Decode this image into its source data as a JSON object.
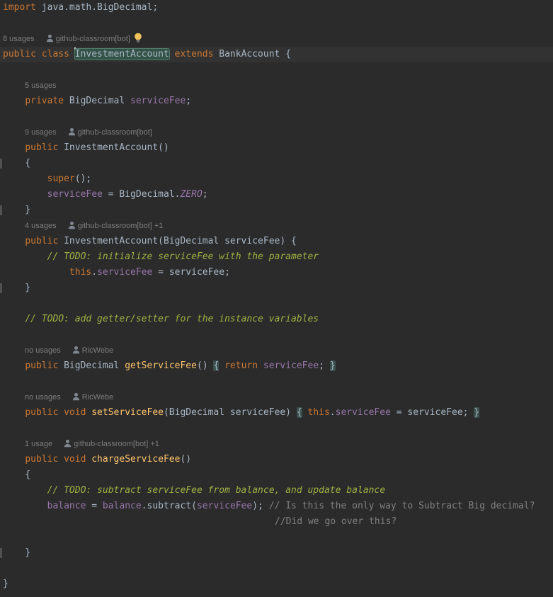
{
  "colors": {
    "background": "#2b2b2b",
    "keyword": "#cc7832",
    "plain": "#a9b7c6",
    "method_name": "#ffc66d",
    "field": "#9876aa",
    "constant": "#9876aa",
    "todo_comment": "#9fb342",
    "comment": "#808080",
    "inlay_hint": "#7d7d7d",
    "identifier_highlight_bg": "#355247",
    "identifier_highlight_border": "#4e7a68",
    "matched_brace_bg": "#3b514d",
    "current_line_bg": "#323232",
    "caret": "#dddddd",
    "fold_marker": "#515151",
    "user_icon": "#808790",
    "bulb_icon": "#f2c55c",
    "bulb_base": "#9aa0a6"
  },
  "editor": {
    "language": "Java",
    "lines": [
      {
        "kind": "code",
        "tokens": [
          {
            "t": "import",
            "c": "kw"
          },
          {
            "t": " java.math.BigDecimal;",
            "c": "pl"
          }
        ]
      },
      {
        "kind": "code",
        "tokens": []
      },
      {
        "kind": "inlay",
        "tokens": [
          {
            "t": "8 usages",
            "c": "inlay"
          },
          {
            "sp": 16
          },
          {
            "icon": "user"
          },
          {
            "sp": 3
          },
          {
            "t": "github-classroom[bot]",
            "c": "inlay"
          },
          {
            "sp": 5
          },
          {
            "icon": "bulb"
          }
        ]
      },
      {
        "kind": "code",
        "current": true,
        "tokens": [
          {
            "t": "public class ",
            "c": "kw"
          },
          {
            "caret": true
          },
          {
            "t": "InvestmentAccount",
            "c": "pl",
            "hl": "ident"
          },
          {
            "t": " ",
            "c": "pl"
          },
          {
            "t": "extends",
            "c": "kw"
          },
          {
            "t": " BankAccount {",
            "c": "pl"
          }
        ]
      },
      {
        "kind": "code",
        "tokens": []
      },
      {
        "kind": "inlay",
        "tokens": [
          {
            "sp": 31
          },
          {
            "t": "5 usages",
            "c": "inlay"
          }
        ]
      },
      {
        "kind": "code",
        "tokens": [
          {
            "t": "    ",
            "c": "pl"
          },
          {
            "t": "private",
            "c": "kw"
          },
          {
            "t": " BigDecimal ",
            "c": "pl"
          },
          {
            "t": "serviceFee",
            "c": "fld"
          },
          {
            "t": ";",
            "c": "pl"
          }
        ]
      },
      {
        "kind": "code",
        "tokens": []
      },
      {
        "kind": "inlay",
        "tokens": [
          {
            "sp": 31
          },
          {
            "t": "9 usages",
            "c": "inlay"
          },
          {
            "sp": 16
          },
          {
            "icon": "user"
          },
          {
            "sp": 3
          },
          {
            "t": "github-classroom[bot]",
            "c": "inlay"
          }
        ]
      },
      {
        "kind": "code",
        "tokens": [
          {
            "t": "    ",
            "c": "pl"
          },
          {
            "t": "public",
            "c": "kw"
          },
          {
            "t": " InvestmentAccount()",
            "c": "pl"
          }
        ]
      },
      {
        "kind": "code",
        "gutterMark": true,
        "tokens": [
          {
            "t": "    {",
            "c": "pl"
          }
        ]
      },
      {
        "kind": "code",
        "tokens": [
          {
            "t": "        ",
            "c": "pl"
          },
          {
            "t": "super",
            "c": "kw"
          },
          {
            "t": "();",
            "c": "pl"
          }
        ]
      },
      {
        "kind": "code",
        "tokens": [
          {
            "t": "        ",
            "c": "pl"
          },
          {
            "t": "serviceFee",
            "c": "fld"
          },
          {
            "t": " = BigDecimal.",
            "c": "pl"
          },
          {
            "t": "ZERO",
            "c": "cst"
          },
          {
            "t": ";",
            "c": "pl"
          }
        ]
      },
      {
        "kind": "code",
        "gutterMark": true,
        "tokens": [
          {
            "t": "    }",
            "c": "pl"
          }
        ]
      },
      {
        "kind": "inlay",
        "tokens": [
          {
            "sp": 31
          },
          {
            "t": "4 usages",
            "c": "inlay"
          },
          {
            "sp": 16
          },
          {
            "icon": "user"
          },
          {
            "sp": 3
          },
          {
            "t": "github-classroom[bot] +1",
            "c": "inlay"
          }
        ]
      },
      {
        "kind": "code",
        "tokens": [
          {
            "t": "    ",
            "c": "pl"
          },
          {
            "t": "public",
            "c": "kw"
          },
          {
            "t": " InvestmentAccount(BigDecimal serviceFee) {",
            "c": "pl"
          }
        ]
      },
      {
        "kind": "code",
        "tokens": [
          {
            "t": "        ",
            "c": "pl"
          },
          {
            "t": "// TODO: initialize serviceFee with the parameter",
            "c": "todo"
          }
        ]
      },
      {
        "kind": "code",
        "tokens": [
          {
            "t": "            ",
            "c": "pl"
          },
          {
            "t": "this",
            "c": "kw"
          },
          {
            "t": ".",
            "c": "pl"
          },
          {
            "t": "serviceFee",
            "c": "fld"
          },
          {
            "t": " = serviceFee;",
            "c": "pl"
          }
        ]
      },
      {
        "kind": "code",
        "gutterMark": true,
        "tokens": [
          {
            "t": "    }",
            "c": "pl"
          }
        ]
      },
      {
        "kind": "code",
        "tokens": []
      },
      {
        "kind": "code",
        "tokens": [
          {
            "t": "    ",
            "c": "pl"
          },
          {
            "t": "// TODO: add getter/setter for the instance variables",
            "c": "todo"
          }
        ]
      },
      {
        "kind": "code",
        "tokens": []
      },
      {
        "kind": "inlay",
        "tokens": [
          {
            "sp": 31
          },
          {
            "t": "no usages",
            "c": "inlay"
          },
          {
            "sp": 16
          },
          {
            "icon": "user"
          },
          {
            "sp": 3
          },
          {
            "t": "RicWebe",
            "c": "inlay"
          }
        ]
      },
      {
        "kind": "code",
        "tokens": [
          {
            "t": "    ",
            "c": "pl"
          },
          {
            "t": "public",
            "c": "kw"
          },
          {
            "t": " BigDecimal ",
            "c": "pl"
          },
          {
            "t": "getServiceFee",
            "c": "fn"
          },
          {
            "t": "() ",
            "c": "pl"
          },
          {
            "t": "{",
            "c": "pl",
            "hl": "brace"
          },
          {
            "t": " ",
            "c": "pl"
          },
          {
            "t": "return",
            "c": "kw"
          },
          {
            "t": " ",
            "c": "pl"
          },
          {
            "t": "serviceFee",
            "c": "fld"
          },
          {
            "t": "; ",
            "c": "pl"
          },
          {
            "t": "}",
            "c": "pl",
            "hl": "brace"
          }
        ]
      },
      {
        "kind": "code",
        "tokens": []
      },
      {
        "kind": "inlay",
        "tokens": [
          {
            "sp": 31
          },
          {
            "t": "no usages",
            "c": "inlay"
          },
          {
            "sp": 16
          },
          {
            "icon": "user"
          },
          {
            "sp": 3
          },
          {
            "t": "RicWebe",
            "c": "inlay"
          }
        ]
      },
      {
        "kind": "code",
        "tokens": [
          {
            "t": "    ",
            "c": "pl"
          },
          {
            "t": "public void",
            "c": "kw"
          },
          {
            "t": " ",
            "c": "pl"
          },
          {
            "t": "setServiceFee",
            "c": "fn"
          },
          {
            "t": "(BigDecimal serviceFee) ",
            "c": "pl"
          },
          {
            "t": "{",
            "c": "pl",
            "hl": "brace"
          },
          {
            "t": " ",
            "c": "pl"
          },
          {
            "t": "this",
            "c": "kw"
          },
          {
            "t": ".",
            "c": "pl"
          },
          {
            "t": "serviceFee",
            "c": "fld"
          },
          {
            "t": " = serviceFee; ",
            "c": "pl"
          },
          {
            "t": "}",
            "c": "pl",
            "hl": "brace"
          }
        ]
      },
      {
        "kind": "code",
        "tokens": []
      },
      {
        "kind": "inlay",
        "tokens": [
          {
            "sp": 31
          },
          {
            "t": "1 usage",
            "c": "inlay"
          },
          {
            "sp": 16
          },
          {
            "icon": "user"
          },
          {
            "sp": 3
          },
          {
            "t": "github-classroom[bot] +1",
            "c": "inlay"
          }
        ]
      },
      {
        "kind": "code",
        "tokens": [
          {
            "t": "    ",
            "c": "pl"
          },
          {
            "t": "public void",
            "c": "kw"
          },
          {
            "t": " ",
            "c": "pl"
          },
          {
            "t": "chargeServiceFee",
            "c": "fn"
          },
          {
            "t": "()",
            "c": "pl"
          }
        ]
      },
      {
        "kind": "code",
        "tokens": [
          {
            "t": "    {",
            "c": "pl"
          }
        ]
      },
      {
        "kind": "code",
        "tokens": [
          {
            "t": "        ",
            "c": "pl"
          },
          {
            "t": "// TODO: subtract serviceFee from balance, and update balance",
            "c": "todo"
          }
        ]
      },
      {
        "kind": "code",
        "tokens": [
          {
            "t": "        ",
            "c": "pl"
          },
          {
            "t": "balance",
            "c": "fld"
          },
          {
            "t": " = ",
            "c": "pl"
          },
          {
            "t": "balance",
            "c": "fld"
          },
          {
            "t": ".subtract(",
            "c": "pl"
          },
          {
            "t": "serviceFee",
            "c": "fld"
          },
          {
            "t": "); ",
            "c": "pl"
          },
          {
            "t": "// Is this the only way to Subtract Big decimal?",
            "c": "cmt"
          }
        ]
      },
      {
        "kind": "code",
        "tokens": [
          {
            "sp": 384
          },
          {
            "t": "//Did we go over this?",
            "c": "cmt"
          }
        ]
      },
      {
        "kind": "code",
        "tokens": []
      },
      {
        "kind": "code",
        "gutterMark": true,
        "tokens": [
          {
            "t": "    }",
            "c": "pl"
          }
        ]
      },
      {
        "kind": "code",
        "tokens": []
      },
      {
        "kind": "code",
        "tokens": [
          {
            "t": "}",
            "c": "pl"
          }
        ]
      }
    ]
  }
}
